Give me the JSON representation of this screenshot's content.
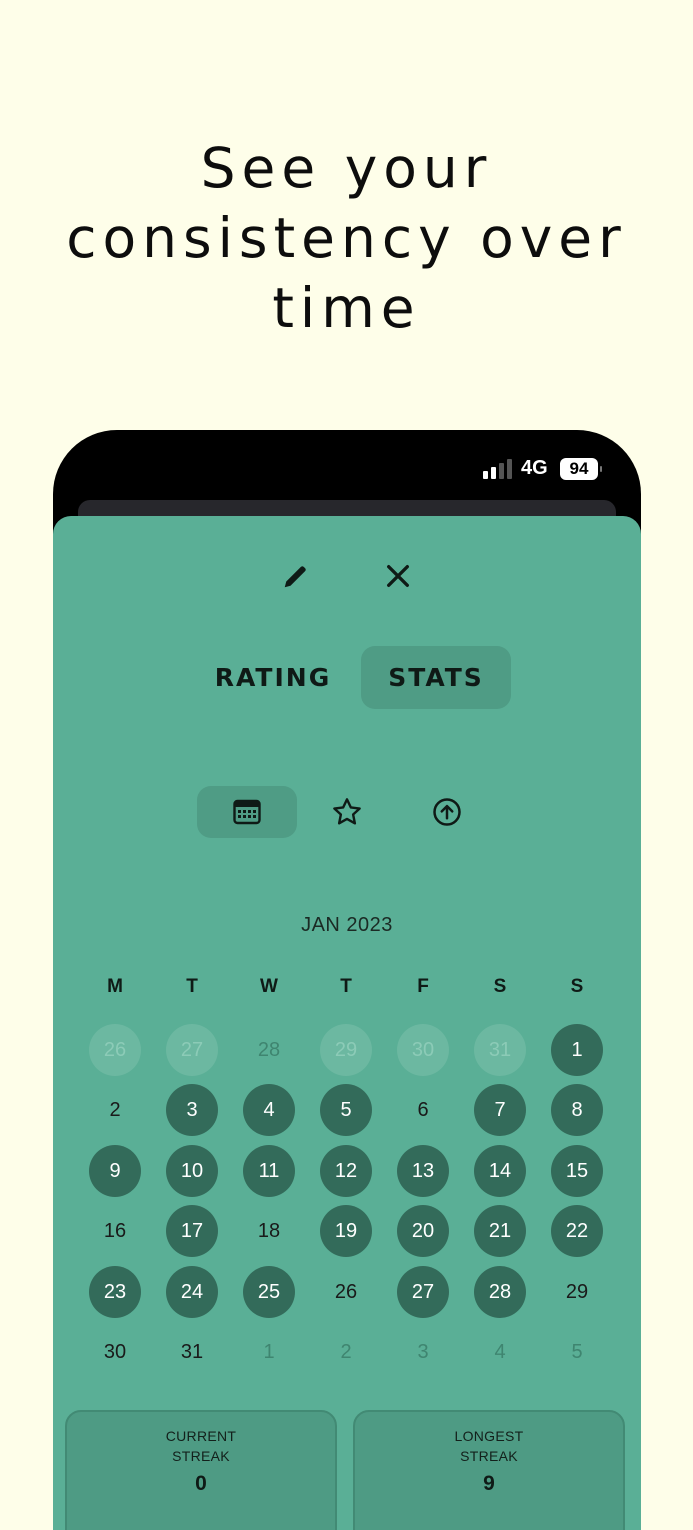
{
  "headline": {
    "line1": "See your",
    "line2": "consistency over",
    "line3": "time"
  },
  "status_bar": {
    "network": "4G",
    "battery": "94"
  },
  "toolbar": {
    "edit_icon": "pencil-icon",
    "close_icon": "close-icon"
  },
  "tabs": [
    {
      "label": "RATING",
      "active": false
    },
    {
      "label": "STATS",
      "active": true
    }
  ],
  "view_switch": [
    {
      "icon": "calendar-icon",
      "active": true
    },
    {
      "icon": "star-icon",
      "active": false
    },
    {
      "icon": "arrow-up-circle-icon",
      "active": false
    }
  ],
  "calendar": {
    "month": "JAN 2023",
    "weekdays": [
      "M",
      "T",
      "W",
      "T",
      "F",
      "S",
      "S"
    ],
    "weeks": [
      [
        {
          "d": "26",
          "m": false,
          "done": true
        },
        {
          "d": "27",
          "m": false,
          "done": true
        },
        {
          "d": "28",
          "m": false,
          "done": false
        },
        {
          "d": "29",
          "m": false,
          "done": true
        },
        {
          "d": "30",
          "m": false,
          "done": true
        },
        {
          "d": "31",
          "m": false,
          "done": true
        },
        {
          "d": "1",
          "m": true,
          "done": true
        }
      ],
      [
        {
          "d": "2",
          "m": true,
          "done": false
        },
        {
          "d": "3",
          "m": true,
          "done": true
        },
        {
          "d": "4",
          "m": true,
          "done": true
        },
        {
          "d": "5",
          "m": true,
          "done": true
        },
        {
          "d": "6",
          "m": true,
          "done": false
        },
        {
          "d": "7",
          "m": true,
          "done": true
        },
        {
          "d": "8",
          "m": true,
          "done": true
        }
      ],
      [
        {
          "d": "9",
          "m": true,
          "done": true
        },
        {
          "d": "10",
          "m": true,
          "done": true
        },
        {
          "d": "11",
          "m": true,
          "done": true
        },
        {
          "d": "12",
          "m": true,
          "done": true
        },
        {
          "d": "13",
          "m": true,
          "done": true
        },
        {
          "d": "14",
          "m": true,
          "done": true
        },
        {
          "d": "15",
          "m": true,
          "done": true
        }
      ],
      [
        {
          "d": "16",
          "m": true,
          "done": false
        },
        {
          "d": "17",
          "m": true,
          "done": true
        },
        {
          "d": "18",
          "m": true,
          "done": false
        },
        {
          "d": "19",
          "m": true,
          "done": true
        },
        {
          "d": "20",
          "m": true,
          "done": true
        },
        {
          "d": "21",
          "m": true,
          "done": true
        },
        {
          "d": "22",
          "m": true,
          "done": true
        }
      ],
      [
        {
          "d": "23",
          "m": true,
          "done": true
        },
        {
          "d": "24",
          "m": true,
          "done": true
        },
        {
          "d": "25",
          "m": true,
          "done": true
        },
        {
          "d": "26",
          "m": true,
          "done": false
        },
        {
          "d": "27",
          "m": true,
          "done": true
        },
        {
          "d": "28",
          "m": true,
          "done": true
        },
        {
          "d": "29",
          "m": true,
          "done": false
        }
      ],
      [
        {
          "d": "30",
          "m": true,
          "done": false
        },
        {
          "d": "31",
          "m": true,
          "done": false
        },
        {
          "d": "1",
          "m": false,
          "done": false
        },
        {
          "d": "2",
          "m": false,
          "done": false
        },
        {
          "d": "3",
          "m": false,
          "done": false
        },
        {
          "d": "4",
          "m": false,
          "done": false
        },
        {
          "d": "5",
          "m": false,
          "done": false
        }
      ]
    ]
  },
  "streaks": {
    "current": {
      "label_line1": "CURRENT",
      "label_line2": "STREAK",
      "value": "0"
    },
    "longest": {
      "label_line1": "LONGEST",
      "label_line2": "STREAK",
      "value": "9"
    }
  },
  "colors": {
    "page_bg": "#fefee9",
    "sheet": "#5aaf96",
    "completed_day": "#336b5a",
    "active_tab": "#4f9c85"
  }
}
